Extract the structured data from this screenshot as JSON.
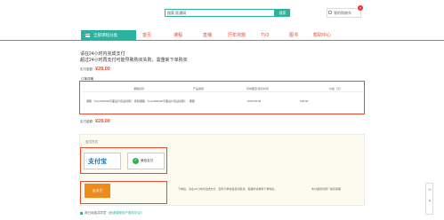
{
  "header": {
    "search_value": "搜索 医通网",
    "search_button": "搜索",
    "cart_label": "我的购物车",
    "cart_count": "0"
  },
  "nav": {
    "category_label": "全部课程分类",
    "items": [
      "首页",
      "课程",
      "直播",
      "历年完题",
      "TV3",
      "图书",
      "帮助中心"
    ]
  },
  "notice": {
    "line1": "请在24小时内完成支付",
    "line2": "超过24小时再支付可能导致购买失败，需重新下单购买"
  },
  "amount": {
    "label": "实付金额:",
    "value": "¥28.00"
  },
  "order": {
    "title": "订单详情",
    "headers": [
      "课程名称",
      "产品类型",
      "有效期至/延长时间",
      "价格（元）"
    ],
    "row": {
      "name": "课程 《CorelDRAW平面设计实战训练》  视频课程  《CorelDRAW平面设计实战训练》 - 课程",
      "date": "2020-05-06",
      "price": "¥28.00"
    }
  },
  "payment": {
    "title": "支付方式",
    "alipay_text": "支付宝",
    "wechat_label": "微信支付",
    "pay_button": "去支付",
    "tip_left": "下单后，请在24小时内完成支付，否则订单将会自动取消，若超时请重新下单购买。",
    "tip_right": "支付遇到问题？联系客服"
  },
  "agreement": {
    "text": "我已阅读并同意",
    "link": "《医通课程用户服务协议》"
  },
  "colors": {
    "accent": "#2bb3a0",
    "highlight": "#e64c2e",
    "pay_button": "#ef8a1b"
  }
}
